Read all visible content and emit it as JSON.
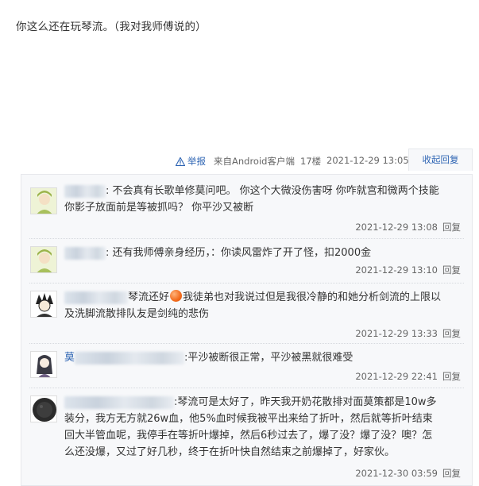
{
  "post": {
    "text": "你这么还在玩琴流。（我对我师傅说的）"
  },
  "meta": {
    "report_label": "举报",
    "source": "来自Android客户端",
    "floor": "17楼",
    "time": "2021-12-29 13:05",
    "collapse_label": "收起回复"
  },
  "replies": [
    {
      "line1": ": 不会真有长歌单修莫问吧。 你这个大微没伤害呀 你咋就宫和微两个技能",
      "line2": "你影子放面前是等被抓吗？ 你平沙又被断",
      "time": "2021-12-29 13:08",
      "reply_label": "回复"
    },
    {
      "line1": ": 还有我师傅亲身经历，：你读风雷炸了开了怪，扣2000金",
      "time": "2021-12-29 13:10",
      "reply_label": "回复"
    },
    {
      "line1a": "琴流还好",
      "line1b": "我徒弟也对我说过但是我很冷静的和她分析剑流的上限以",
      "line2": "及洗脚流散排队友是剑纯的悲伤",
      "time": "2021-12-29 13:33",
      "reply_label": "回复"
    },
    {
      "user_prefix": "莫",
      "line1": ":平沙被断很正常，平沙被黑就很难受",
      "time": "2021-12-29 22:41",
      "reply_label": "回复"
    },
    {
      "line1": ":琴流可是太好了，昨天我开奶花散排对面莫策都是10w多",
      "line2": "装分，我方无方就26w血，他5%血时候我被平出来给了折叶，然后就等折叶结束",
      "line3": "回大半管血呢，我停手在等折叶爆掉，然后6秒过去了，爆了没？爆了没？噢？怎",
      "line4": "么还没爆，又过了好几秒，终于在折叶快自然结束之前爆掉了，好家伙。",
      "time": "2021-12-30 03:59",
      "reply_label": "回复"
    }
  ]
}
